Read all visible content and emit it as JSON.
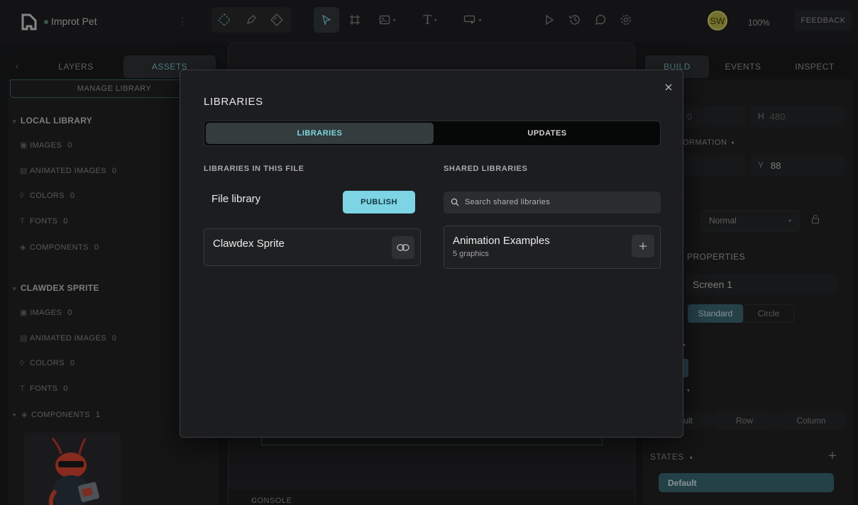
{
  "app": {
    "project_name": "Improt Pet",
    "zoom": "100%",
    "avatar_initials": "SW",
    "feedback_label": "FEEDBACK",
    "accent_color": "#7dd4e4"
  },
  "left_panel": {
    "tabs": [
      "LAYERS",
      "ASSETS"
    ],
    "active_tab": "ASSETS",
    "manage_library_label": "MANAGE LIBRARY",
    "local_library": {
      "title": "LOCAL LIBRARY",
      "rows": [
        {
          "label": "IMAGES",
          "count": "0"
        },
        {
          "label": "ANIMATED IMAGES",
          "count": "0"
        },
        {
          "label": "COLORS",
          "count": "0"
        },
        {
          "label": "FONTS",
          "count": "0"
        },
        {
          "label": "COMPONENTS",
          "count": "0"
        }
      ]
    },
    "clawdex_sprite": {
      "title": "CLAWDEX SPRITE",
      "rows": [
        {
          "label": "IMAGES",
          "count": "0"
        },
        {
          "label": "ANIMATED IMAGES",
          "count": "0"
        },
        {
          "label": "COLORS",
          "count": "0"
        },
        {
          "label": "FONTS",
          "count": "0"
        },
        {
          "label": "COMPONENTS",
          "count": "1"
        }
      ]
    }
  },
  "canvas": {
    "console_label": "CONSOLE"
  },
  "right_panel": {
    "tabs": [
      "BUILD",
      "EVENTS",
      "INSPECT"
    ],
    "active_tab": "BUILD",
    "w_value": "0",
    "h_label": "H",
    "h_value": "480",
    "transformation_label": "ORMATION",
    "y_label": "Y",
    "y_value": "88",
    "blend_mode": "Normal",
    "properties_label": "PROPERTIES",
    "screen_name": "Screen 1",
    "shape_options": [
      "Standard",
      "Circle"
    ],
    "layout_options": [
      "ult",
      "Row",
      "Column"
    ],
    "states_label": "STATES",
    "default_state": "Default"
  },
  "modal": {
    "title": "LIBRARIES",
    "tabs": {
      "libraries": "LIBRARIES",
      "updates": "UPDATES"
    },
    "left_col_heading": "LIBRARIES IN THIS FILE",
    "file_library_label": "File library",
    "publish_label": "PUBLISH",
    "file_libraries": [
      {
        "name": "Clawdex Sprite"
      }
    ],
    "right_col_heading": "SHARED LIBRARIES",
    "search_placeholder": "Search shared libraries",
    "shared_libraries": [
      {
        "name": "Animation Examples",
        "subtitle": "5 graphics"
      }
    ]
  }
}
